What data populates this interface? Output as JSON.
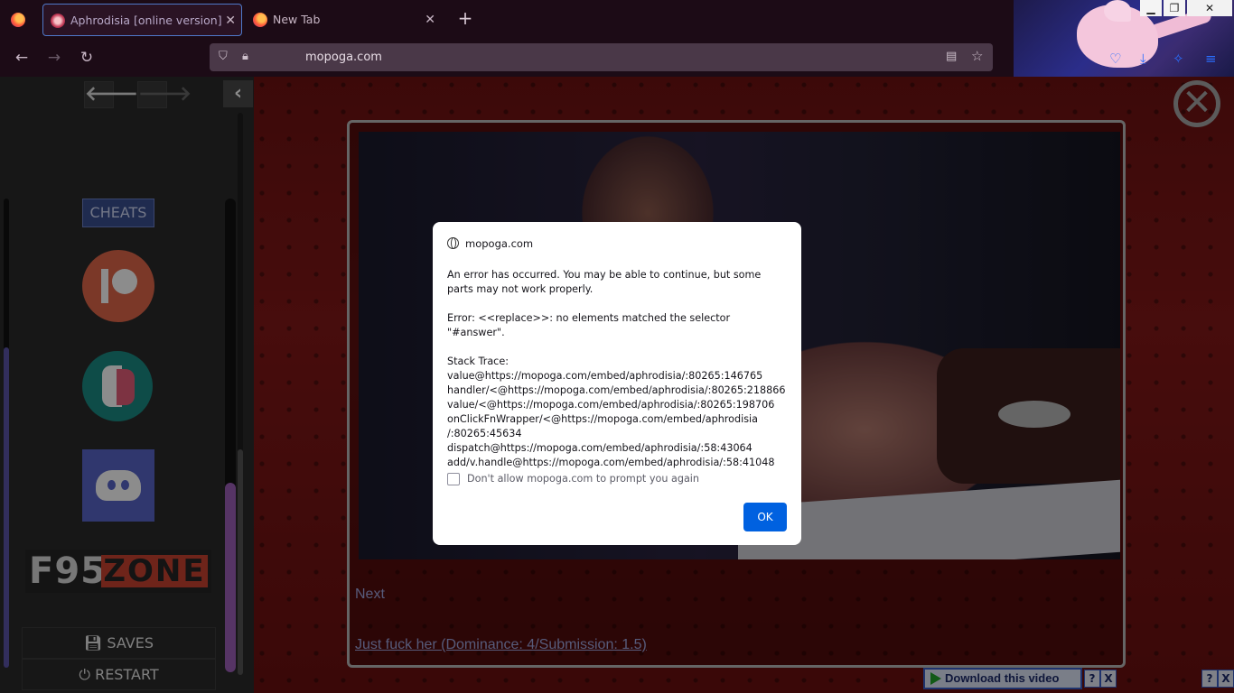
{
  "browser": {
    "tabs": [
      {
        "title": "Aphrodisia [online version] inte",
        "active": true
      },
      {
        "title": "New Tab",
        "active": false
      }
    ],
    "url": "mopoga.com",
    "accent": "#4f78c9"
  },
  "sidebar": {
    "cheats_label": "CHEATS",
    "f95_left": "F95",
    "f95_right": "ZONE",
    "saves_label": "SAVES",
    "restart_label": "RESTART"
  },
  "passage": {
    "next_link": "Next",
    "choice_link": "Just fuck her (Dominance: 4/Submission: 1.5)"
  },
  "download_bar": {
    "button_label": "Download this video",
    "second_label": "ad this video",
    "help": "?",
    "close": "X"
  },
  "dialog": {
    "origin": "mopoga.com",
    "message": "An error has occurred. You may be able to continue, but some parts may not work properly.",
    "error": "Error: <<replace>>: no elements matched the selector \"#answer\".",
    "stack_title": "Stack Trace:",
    "stack_lines": [
      "value@https://mopoga.com/embed/aphrodisia/:80265:146765",
      "handler/<@https://mopoga.com/embed/aphrodisia/:80265:218866",
      "value/<@https://mopoga.com/embed/aphrodisia/:80265:198706",
      "onClickFnWrapper/<@https://mopoga.com/embed/aphrodisia",
      "/:80265:45634",
      "dispatch@https://mopoga.com/embed/aphrodisia/:58:43064",
      "add/v.handle@https://mopoga.com/embed/aphrodisia/:58:41048"
    ],
    "checkbox_label": "Don't allow mopoga.com to prompt you again",
    "ok_label": "OK",
    "ok_color": "#0061e0"
  }
}
